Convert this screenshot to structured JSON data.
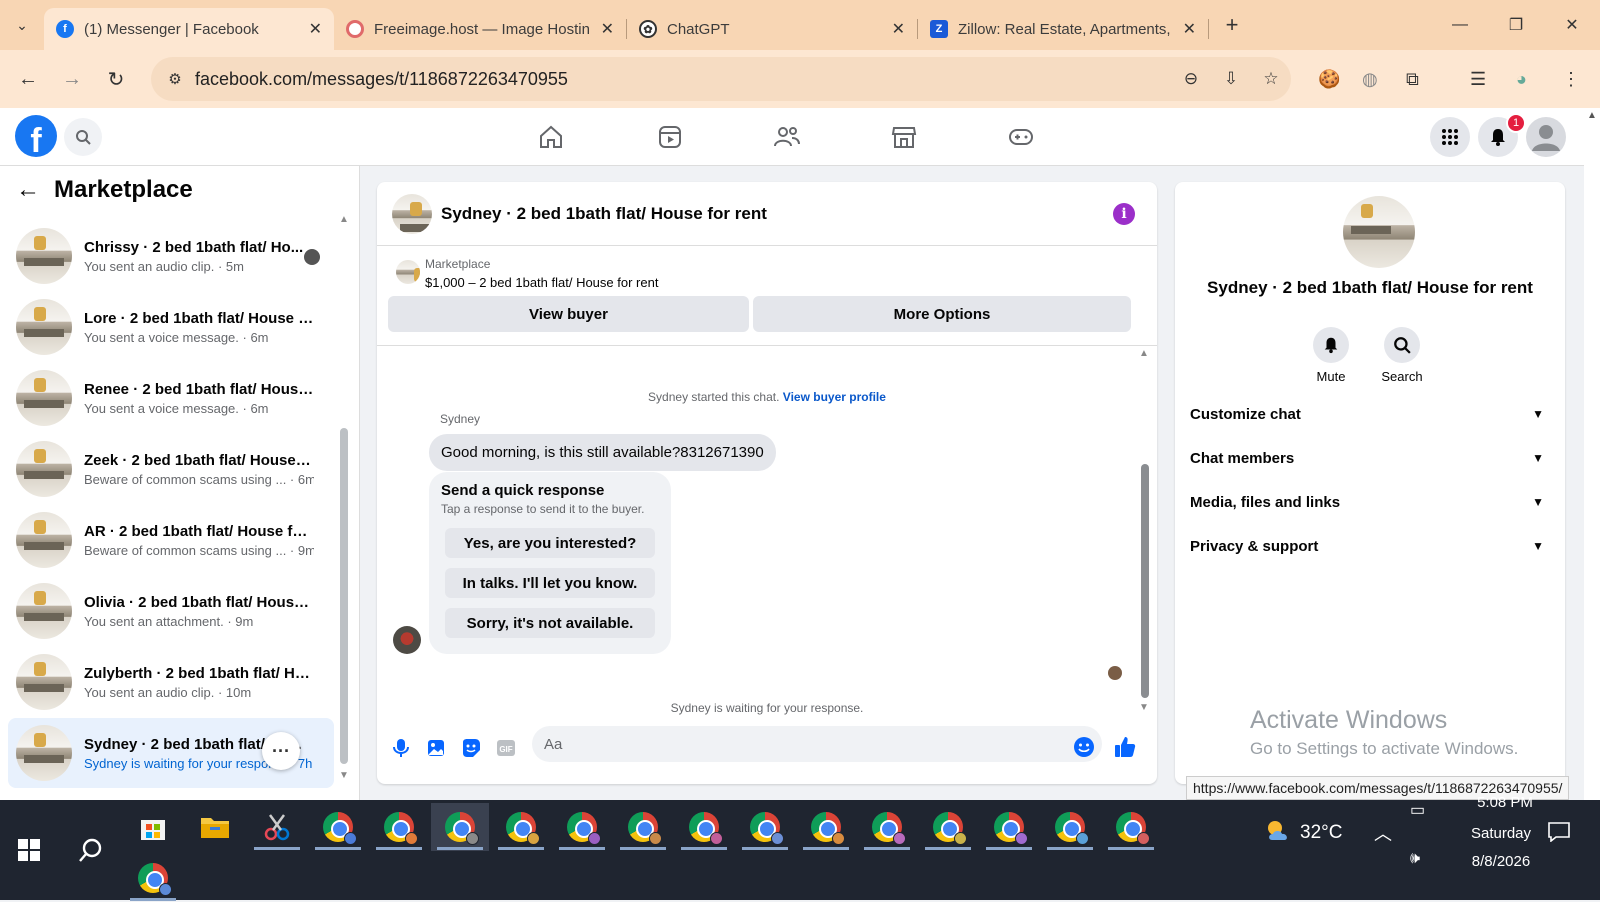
{
  "browser": {
    "tabs": [
      {
        "title": "(1) Messenger | Facebook",
        "favicon": "facebook-icon",
        "active": true
      },
      {
        "title": "Freeimage.host — Image Hostin",
        "favicon": "freeimage-icon",
        "active": false
      },
      {
        "title": "ChatGPT",
        "favicon": "chatgpt-icon",
        "active": false
      },
      {
        "title": "Zillow: Real Estate, Apartments,",
        "favicon": "zillow-icon",
        "active": false
      }
    ],
    "new_tab": "+",
    "url": "facebook.com/messages/t/1186872263470955"
  },
  "fb": {
    "notification_count": "1",
    "brand_color": "#1877f2"
  },
  "sidebar": {
    "title": "Marketplace",
    "conversations": [
      {
        "name": "Chrissy · 2 bed 1bath flat/ Ho...",
        "preview": "You sent an audio clip. · 5m"
      },
      {
        "name": "Lore · 2 bed 1bath flat/ House f...",
        "preview": "You sent a voice message. · 6m"
      },
      {
        "name": "Renee · 2 bed 1bath flat/ House...",
        "preview": "You sent a voice message. · 6m"
      },
      {
        "name": "Zeek · 2 bed 1bath flat/ House f...",
        "preview": "Beware of common scams using ... · 6m"
      },
      {
        "name": "AR · 2 bed 1bath flat/ House for...",
        "preview": "Beware of common scams using ... · 9m"
      },
      {
        "name": "Olivia · 2 bed 1bath flat/ House ...",
        "preview": "You sent an attachment. · 9m"
      },
      {
        "name": "Zulyberth · 2 bed 1bath flat/ Ho...",
        "preview": "You sent an audio clip. · 10m"
      },
      {
        "name": "Sydney · 2 bed 1bath flat/ Ho...",
        "preview": "Sydney is waiting for your respon... · 7h"
      }
    ]
  },
  "chat": {
    "title": "Sydney · 2 bed 1bath flat/ House for rent",
    "listing_label": "Marketplace",
    "listing_price": "$1,000 – 2 bed 1bath flat/ House for rent",
    "view_buyer": "View buyer",
    "more_options": "More Options",
    "started_text": "Sydney started this chat.",
    "view_profile": "View buyer profile",
    "sender": "Sydney",
    "message": "Good morning, is this still available?8312671390",
    "quick_title": "Send a quick response",
    "quick_sub": "Tap a response to send it to the buyer.",
    "quick_responses": [
      "Yes, are you interested?",
      "In talks. I'll let you know.",
      "Sorry, it's not available."
    ],
    "waiting_text": "Sydney is waiting for your response.",
    "input_placeholder": "Aa"
  },
  "details": {
    "name": "Sydney · 2 bed 1bath flat/ House for rent",
    "mute": "Mute",
    "search": "Search",
    "sections": [
      "Customize chat",
      "Chat members",
      "Media, files and links",
      "Privacy & support"
    ]
  },
  "overlay": {
    "activate_title": "Activate Windows",
    "activate_sub": "Go to Settings to activate Windows.",
    "status_url": "https://www.facebook.com/messages/t/1186872263470955/"
  },
  "taskbar": {
    "weather": "32°C",
    "time": "5:08 PM",
    "day": "Saturday",
    "date": "8/8/2026"
  }
}
